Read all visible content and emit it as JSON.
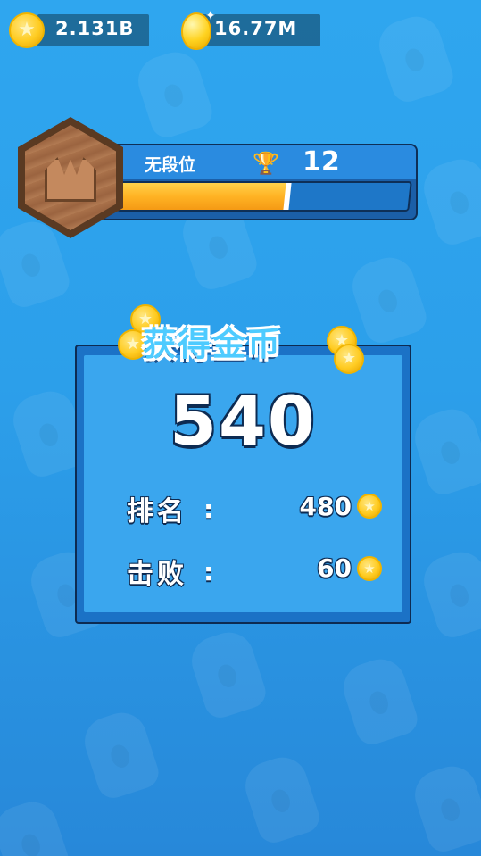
{
  "currency": {
    "gold": {
      "amount": "2.131B",
      "icon": "coin-icon"
    },
    "gem": {
      "amount": "16.77M",
      "icon": "gold-egg-icon"
    }
  },
  "rank": {
    "name": "无段位",
    "trophies": "12",
    "trophy_icon": "trophy-icon",
    "badge_icon": "bronze-crown-badge-icon",
    "progress": 0.58
  },
  "reward": {
    "title": "获得金币",
    "amount": "540",
    "rows": [
      {
        "label": "排名",
        "colon": ":",
        "value": "480"
      },
      {
        "label": "击败",
        "colon": ":",
        "value": "60"
      }
    ]
  },
  "colors": {
    "background": "#2fa6ef",
    "panel": "#1b72c6",
    "coin": "#ffcc22",
    "progress": "#ffb324"
  }
}
